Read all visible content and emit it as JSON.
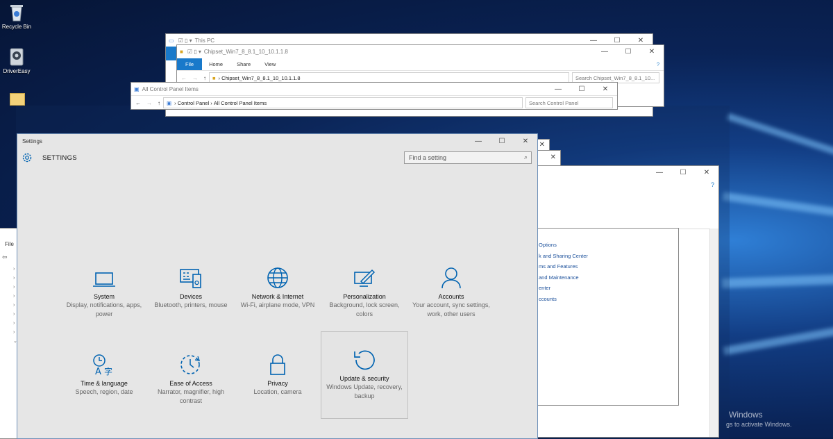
{
  "desktop": {
    "icons": [
      {
        "label": "Recycle Bin"
      },
      {
        "label": "DriverEasy"
      }
    ],
    "watermark": {
      "line1": "Windows",
      "line2": "gs to activate Windows."
    }
  },
  "window_this_pc": {
    "title": "This PC"
  },
  "window_chipset": {
    "title": "Chipset_Win7_8_8.1_10_10.1.1.8",
    "ribbon_tabs": [
      "File",
      "Home",
      "Share",
      "View"
    ],
    "address": "Chipset_Win7_8_8.1_10_10.1.1.8",
    "search_placeholder": "Search Chipset_Win7_8_8.1_10..."
  },
  "window_control_panel": {
    "title": "All Control Panel Items",
    "breadcrumb_1": "Control Panel",
    "breadcrumb_2": "All Control Panel Items",
    "search_placeholder": "Search Control Panel"
  },
  "left_window": {
    "menu_file": "File"
  },
  "right_window": {
    "links": [
      "Options",
      "k and Sharing Center",
      "ms and Features",
      "and Maintenance",
      "enter",
      "ccounts"
    ]
  },
  "settings": {
    "window_title": "Settings",
    "header": "SETTINGS",
    "search_placeholder": "Find a setting",
    "tiles": [
      {
        "name": "System",
        "desc": "Display, notifications, apps, power",
        "icon": "laptop-icon"
      },
      {
        "name": "Devices",
        "desc": "Bluetooth, printers, mouse",
        "icon": "devices-icon"
      },
      {
        "name": "Network & Internet",
        "desc": "Wi-Fi, airplane mode, VPN",
        "icon": "globe-icon"
      },
      {
        "name": "Personalization",
        "desc": "Background, lock screen, colors",
        "icon": "paint-icon"
      },
      {
        "name": "Accounts",
        "desc": "Your account, sync settings, work, other users",
        "icon": "person-icon"
      },
      {
        "name": "Time & language",
        "desc": "Speech, region, date",
        "icon": "time-language-icon"
      },
      {
        "name": "Ease of Access",
        "desc": "Narrator, magnifier, high contrast",
        "icon": "ease-of-access-icon"
      },
      {
        "name": "Privacy",
        "desc": "Location, camera",
        "icon": "lock-icon"
      },
      {
        "name": "Update & security",
        "desc": "Windows Update, recovery, backup",
        "icon": "refresh-icon"
      }
    ]
  },
  "colors": {
    "accent": "#0063b1",
    "settings_bg": "#e6e6e6"
  }
}
